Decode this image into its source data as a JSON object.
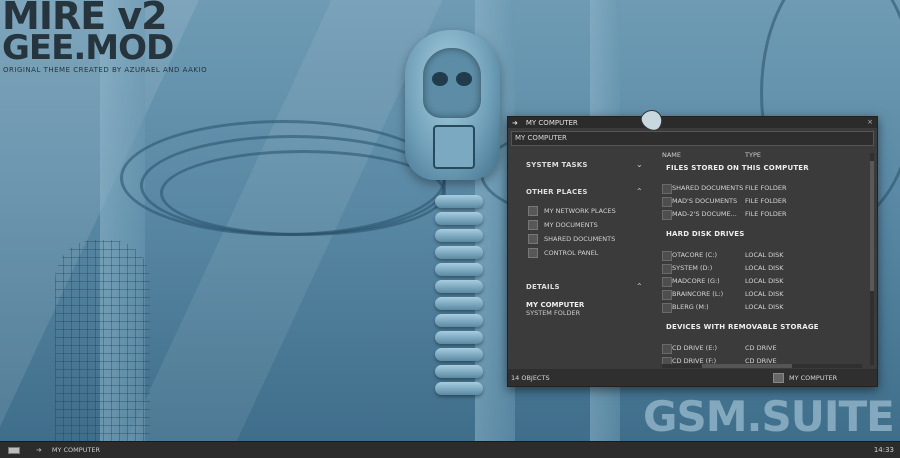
{
  "desktop": {
    "logo_line1": "MIRE v2",
    "logo_line2": "GEE.MOD",
    "logo_credit": "ORIGINAL THEME CREATED BY AZURAEL AND AAKIO",
    "watermark": "GSM.SUITE"
  },
  "window": {
    "title": "MY COMPUTER",
    "address": "MY COMPUTER",
    "close_icon": "×",
    "left_pane": {
      "system_tasks_label": "SYSTEM TASKS",
      "other_places_label": "OTHER PLACES",
      "other_places": [
        {
          "label": "MY NETWORK PLACES",
          "icon": "network-icon"
        },
        {
          "label": "MY DOCUMENTS",
          "icon": "folder-icon"
        },
        {
          "label": "SHARED DOCUMENTS",
          "icon": "folder-icon"
        },
        {
          "label": "CONTROL PANEL",
          "icon": "control-panel-icon"
        }
      ],
      "details_label": "DETAILS",
      "details_title": "MY COMPUTER",
      "details_subtitle": "SYSTEM FOLDER"
    },
    "columns": {
      "name": "NAME",
      "type": "TYPE"
    },
    "groups": [
      {
        "title": "FILES STORED ON THIS COMPUTER",
        "items": [
          {
            "name": "SHARED DOCUMENTS",
            "type": "FILE FOLDER"
          },
          {
            "name": "MAD'S DOCUMENTS",
            "type": "FILE FOLDER"
          },
          {
            "name": "MAD-2'S DOCUME...",
            "type": "FILE FOLDER"
          }
        ]
      },
      {
        "title": "HARD DISK DRIVES",
        "items": [
          {
            "name": "OTACORE (C:)",
            "type": "LOCAL DISK"
          },
          {
            "name": "SYSTEM (D:)",
            "type": "LOCAL DISK"
          },
          {
            "name": "MADCORE (G:)",
            "type": "LOCAL DISK"
          },
          {
            "name": "BRAINCORE (L:)",
            "type": "LOCAL DISK"
          },
          {
            "name": "BLERG (M:)",
            "type": "LOCAL DISK"
          }
        ]
      },
      {
        "title": "DEVICES WITH REMOVABLE STORAGE",
        "items": [
          {
            "name": "CD DRIVE (E:)",
            "type": "CD DRIVE"
          },
          {
            "name": "CD DRIVE (F:)",
            "type": "CD DRIVE"
          }
        ]
      }
    ],
    "status": {
      "left": "14 OBJECTS",
      "right": "MY COMPUTER"
    }
  },
  "taskbar": {
    "task_label": "MY COMPUTER",
    "clock": "14:33"
  },
  "colors": {
    "window_bg": "#3b3b3b",
    "desktop_blue": "#5a89a5"
  }
}
